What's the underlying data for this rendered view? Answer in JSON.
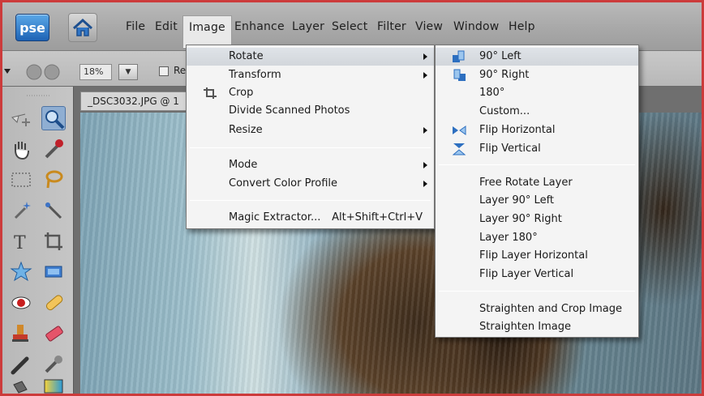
{
  "app": {
    "logo_text": "pse",
    "accent": "#2d6fc0"
  },
  "menubar": {
    "items": [
      "File",
      "Edit",
      "Image",
      "Enhance",
      "Layer",
      "Select",
      "Filter",
      "View",
      "Window",
      "Help"
    ],
    "active": "Image"
  },
  "options_bar": {
    "zoom_value": "18%",
    "checkbox_label": "Re"
  },
  "document": {
    "tab_title": "_DSC3032.JPG @ 1"
  },
  "image_menu": {
    "items": [
      {
        "label": "Rotate",
        "submenu": true,
        "highlighted": true
      },
      {
        "label": "Transform",
        "submenu": true
      },
      {
        "label": "Crop",
        "icon": "crop-icon"
      },
      {
        "label": "Divide Scanned Photos"
      },
      {
        "label": "Resize",
        "submenu": true
      },
      {
        "label": "Mode",
        "submenu": true
      },
      {
        "label": "Convert Color Profile",
        "submenu": true
      },
      {
        "label": "Magic Extractor...",
        "shortcut": "Alt+Shift+Ctrl+V"
      }
    ]
  },
  "rotate_submenu": {
    "items": [
      {
        "label": "90° Left",
        "icon": "rotate-left-icon",
        "highlighted": true
      },
      {
        "label": "90° Right",
        "icon": "rotate-right-icon"
      },
      {
        "label": "180°"
      },
      {
        "label": "Custom..."
      },
      {
        "label": "Flip Horizontal",
        "icon": "flip-horizontal-icon"
      },
      {
        "label": "Flip Vertical",
        "icon": "flip-vertical-icon"
      },
      {
        "label": "Free Rotate Layer"
      },
      {
        "label": "Layer 90° Left"
      },
      {
        "label": "Layer 90° Right"
      },
      {
        "label": "Layer 180°"
      },
      {
        "label": "Flip Layer Horizontal"
      },
      {
        "label": "Flip Layer Vertical"
      },
      {
        "label": "Straighten and Crop Image"
      },
      {
        "label": "Straighten Image"
      }
    ]
  },
  "toolbox": {
    "tools": [
      "move-tool-icon",
      "zoom-tool-icon",
      "hand-tool-icon",
      "eyedropper-tool-icon",
      "marquee-tool-icon",
      "lasso-tool-icon",
      "magic-wand-tool-icon",
      "quick-selection-tool-icon",
      "type-tool-icon",
      "crop-tool-icon",
      "cookie-cutter-tool-icon",
      "straighten-tool-icon",
      "red-eye-tool-icon",
      "healing-brush-tool-icon",
      "clone-stamp-tool-icon",
      "eraser-tool-icon",
      "brush-tool-icon",
      "smart-brush-tool-icon",
      "paint-bucket-tool-icon",
      "gradient-tool-icon"
    ],
    "selected": "zoom-tool-icon"
  }
}
